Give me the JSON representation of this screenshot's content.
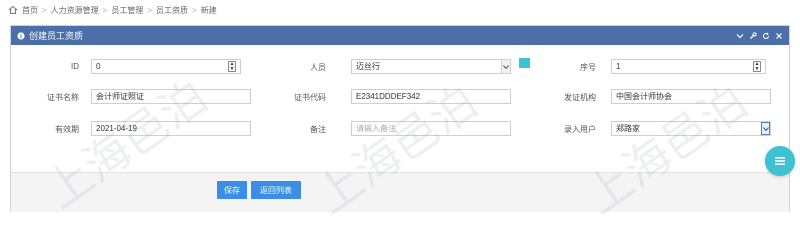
{
  "breadcrumb": {
    "items": [
      "首页",
      "人力资源管理",
      "员工管理",
      "员工资质",
      "新建"
    ],
    "separator": ">"
  },
  "panel": {
    "title": "创建员工资质",
    "header_color": "#4c6fa8"
  },
  "form": {
    "id": {
      "label": "ID",
      "value": "0"
    },
    "person": {
      "label": "人员",
      "value": "迈丝行"
    },
    "seq": {
      "label": "序号",
      "value": "1"
    },
    "cert_name": {
      "label": "证书名称",
      "value": "会计师证照证"
    },
    "cert_code": {
      "label": "证书代码",
      "value": "E2341DDDEF342"
    },
    "issuer": {
      "label": "发证机构",
      "value": "中国会计师协会"
    },
    "valid_until": {
      "label": "有效期",
      "value": "2021-04-19"
    },
    "remark": {
      "label": "备注",
      "placeholder": "请输入备注"
    },
    "entry_user": {
      "label": "录入用户",
      "value": "郑路家"
    }
  },
  "buttons": {
    "save": "保存",
    "back": "返回列表"
  },
  "colors": {
    "accent": "#3a8ee6",
    "teal": "#3ec1d3"
  },
  "watermark": {
    "text": "上海邑泊"
  }
}
